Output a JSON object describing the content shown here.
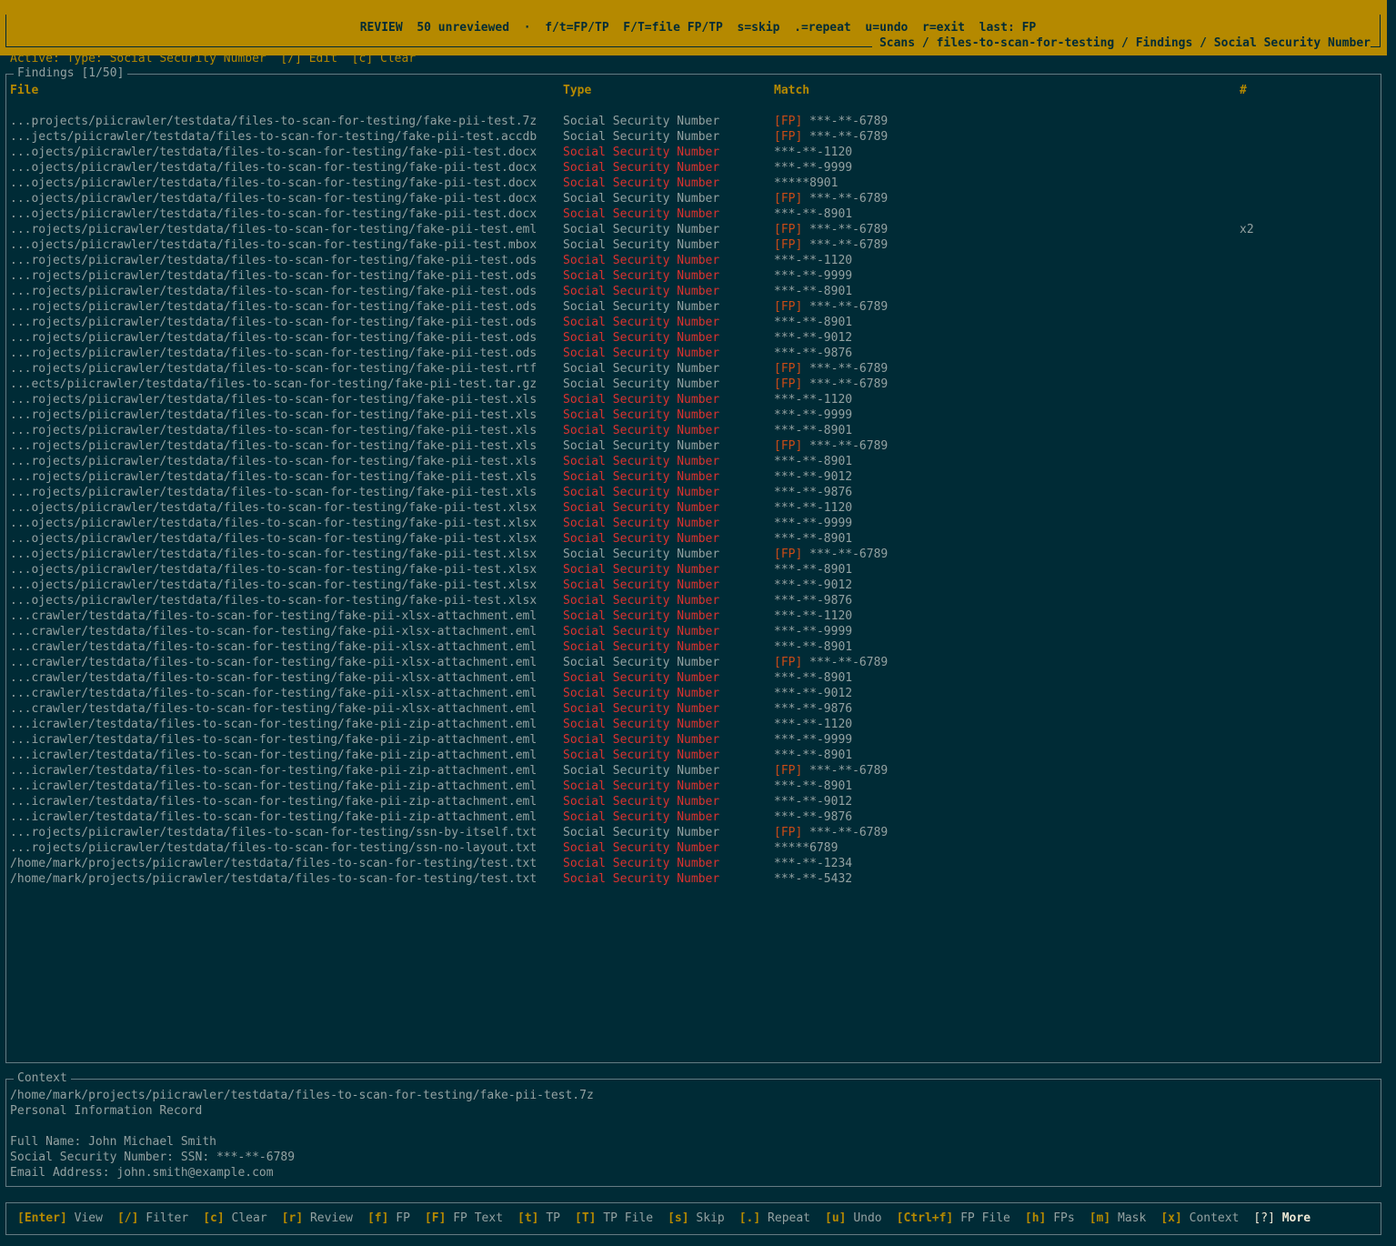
{
  "topbar": {
    "review_line": "REVIEW  50 unreviewed  ·  f/t=FP/TP  F/T=file FP/TP  s=skip  .=repeat  u=undo  r=exit  last: FP",
    "breadcrumb": "Scans / files-to-scan-for-testing / Findings / Social Security Number"
  },
  "active_filter": "Active: Type: Social Security Number  [/] Edit  [c] Clear",
  "findings": {
    "title": "Findings [1/50]",
    "headers": {
      "file": "File",
      "type": "Type",
      "match": "Match",
      "count": "#"
    },
    "rows": [
      {
        "file": "...projects/piicrawler/testdata/files-to-scan-for-testing/fake-pii-test.7z",
        "type": "Social Security Number",
        "fp": "[FP]",
        "match": "***-**-6789",
        "count": "",
        "red": false
      },
      {
        "file": "...jects/piicrawler/testdata/files-to-scan-for-testing/fake-pii-test.accdb",
        "type": "Social Security Number",
        "fp": "[FP]",
        "match": "***-**-6789",
        "count": "",
        "red": false
      },
      {
        "file": "...ojects/piicrawler/testdata/files-to-scan-for-testing/fake-pii-test.docx",
        "type": "Social Security Number",
        "fp": "",
        "match": "***-**-1120",
        "count": "",
        "red": true
      },
      {
        "file": "...ojects/piicrawler/testdata/files-to-scan-for-testing/fake-pii-test.docx",
        "type": "Social Security Number",
        "fp": "",
        "match": "***-**-9999",
        "count": "",
        "red": true
      },
      {
        "file": "...ojects/piicrawler/testdata/files-to-scan-for-testing/fake-pii-test.docx",
        "type": "Social Security Number",
        "fp": "",
        "match": "*****8901",
        "count": "",
        "red": true
      },
      {
        "file": "...ojects/piicrawler/testdata/files-to-scan-for-testing/fake-pii-test.docx",
        "type": "Social Security Number",
        "fp": "[FP]",
        "match": "***-**-6789",
        "count": "",
        "red": false
      },
      {
        "file": "...ojects/piicrawler/testdata/files-to-scan-for-testing/fake-pii-test.docx",
        "type": "Social Security Number",
        "fp": "",
        "match": "***-**-8901",
        "count": "",
        "red": true
      },
      {
        "file": "...rojects/piicrawler/testdata/files-to-scan-for-testing/fake-pii-test.eml",
        "type": "Social Security Number",
        "fp": "[FP]",
        "match": "***-**-6789",
        "count": "x2",
        "red": false
      },
      {
        "file": "...ojects/piicrawler/testdata/files-to-scan-for-testing/fake-pii-test.mbox",
        "type": "Social Security Number",
        "fp": "[FP]",
        "match": "***-**-6789",
        "count": "",
        "red": false
      },
      {
        "file": "...rojects/piicrawler/testdata/files-to-scan-for-testing/fake-pii-test.ods",
        "type": "Social Security Number",
        "fp": "",
        "match": "***-**-1120",
        "count": "",
        "red": true
      },
      {
        "file": "...rojects/piicrawler/testdata/files-to-scan-for-testing/fake-pii-test.ods",
        "type": "Social Security Number",
        "fp": "",
        "match": "***-**-9999",
        "count": "",
        "red": true
      },
      {
        "file": "...rojects/piicrawler/testdata/files-to-scan-for-testing/fake-pii-test.ods",
        "type": "Social Security Number",
        "fp": "",
        "match": "***-**-8901",
        "count": "",
        "red": true
      },
      {
        "file": "...rojects/piicrawler/testdata/files-to-scan-for-testing/fake-pii-test.ods",
        "type": "Social Security Number",
        "fp": "[FP]",
        "match": "***-**-6789",
        "count": "",
        "red": false
      },
      {
        "file": "...rojects/piicrawler/testdata/files-to-scan-for-testing/fake-pii-test.ods",
        "type": "Social Security Number",
        "fp": "",
        "match": "***-**-8901",
        "count": "",
        "red": true
      },
      {
        "file": "...rojects/piicrawler/testdata/files-to-scan-for-testing/fake-pii-test.ods",
        "type": "Social Security Number",
        "fp": "",
        "match": "***-**-9012",
        "count": "",
        "red": true
      },
      {
        "file": "...rojects/piicrawler/testdata/files-to-scan-for-testing/fake-pii-test.ods",
        "type": "Social Security Number",
        "fp": "",
        "match": "***-**-9876",
        "count": "",
        "red": true
      },
      {
        "file": "...rojects/piicrawler/testdata/files-to-scan-for-testing/fake-pii-test.rtf",
        "type": "Social Security Number",
        "fp": "[FP]",
        "match": "***-**-6789",
        "count": "",
        "red": false
      },
      {
        "file": "...ects/piicrawler/testdata/files-to-scan-for-testing/fake-pii-test.tar.gz",
        "type": "Social Security Number",
        "fp": "[FP]",
        "match": "***-**-6789",
        "count": "",
        "red": false
      },
      {
        "file": "...rojects/piicrawler/testdata/files-to-scan-for-testing/fake-pii-test.xls",
        "type": "Social Security Number",
        "fp": "",
        "match": "***-**-1120",
        "count": "",
        "red": true
      },
      {
        "file": "...rojects/piicrawler/testdata/files-to-scan-for-testing/fake-pii-test.xls",
        "type": "Social Security Number",
        "fp": "",
        "match": "***-**-9999",
        "count": "",
        "red": true
      },
      {
        "file": "...rojects/piicrawler/testdata/files-to-scan-for-testing/fake-pii-test.xls",
        "type": "Social Security Number",
        "fp": "",
        "match": "***-**-8901",
        "count": "",
        "red": true
      },
      {
        "file": "...rojects/piicrawler/testdata/files-to-scan-for-testing/fake-pii-test.xls",
        "type": "Social Security Number",
        "fp": "[FP]",
        "match": "***-**-6789",
        "count": "",
        "red": false
      },
      {
        "file": "...rojects/piicrawler/testdata/files-to-scan-for-testing/fake-pii-test.xls",
        "type": "Social Security Number",
        "fp": "",
        "match": "***-**-8901",
        "count": "",
        "red": true
      },
      {
        "file": "...rojects/piicrawler/testdata/files-to-scan-for-testing/fake-pii-test.xls",
        "type": "Social Security Number",
        "fp": "",
        "match": "***-**-9012",
        "count": "",
        "red": true
      },
      {
        "file": "...rojects/piicrawler/testdata/files-to-scan-for-testing/fake-pii-test.xls",
        "type": "Social Security Number",
        "fp": "",
        "match": "***-**-9876",
        "count": "",
        "red": true
      },
      {
        "file": "...ojects/piicrawler/testdata/files-to-scan-for-testing/fake-pii-test.xlsx",
        "type": "Social Security Number",
        "fp": "",
        "match": "***-**-1120",
        "count": "",
        "red": true
      },
      {
        "file": "...ojects/piicrawler/testdata/files-to-scan-for-testing/fake-pii-test.xlsx",
        "type": "Social Security Number",
        "fp": "",
        "match": "***-**-9999",
        "count": "",
        "red": true
      },
      {
        "file": "...ojects/piicrawler/testdata/files-to-scan-for-testing/fake-pii-test.xlsx",
        "type": "Social Security Number",
        "fp": "",
        "match": "***-**-8901",
        "count": "",
        "red": true
      },
      {
        "file": "...ojects/piicrawler/testdata/files-to-scan-for-testing/fake-pii-test.xlsx",
        "type": "Social Security Number",
        "fp": "[FP]",
        "match": "***-**-6789",
        "count": "",
        "red": false
      },
      {
        "file": "...ojects/piicrawler/testdata/files-to-scan-for-testing/fake-pii-test.xlsx",
        "type": "Social Security Number",
        "fp": "",
        "match": "***-**-8901",
        "count": "",
        "red": true
      },
      {
        "file": "...ojects/piicrawler/testdata/files-to-scan-for-testing/fake-pii-test.xlsx",
        "type": "Social Security Number",
        "fp": "",
        "match": "***-**-9012",
        "count": "",
        "red": true
      },
      {
        "file": "...ojects/piicrawler/testdata/files-to-scan-for-testing/fake-pii-test.xlsx",
        "type": "Social Security Number",
        "fp": "",
        "match": "***-**-9876",
        "count": "",
        "red": true
      },
      {
        "file": "...crawler/testdata/files-to-scan-for-testing/fake-pii-xlsx-attachment.eml",
        "type": "Social Security Number",
        "fp": "",
        "match": "***-**-1120",
        "count": "",
        "red": true
      },
      {
        "file": "...crawler/testdata/files-to-scan-for-testing/fake-pii-xlsx-attachment.eml",
        "type": "Social Security Number",
        "fp": "",
        "match": "***-**-9999",
        "count": "",
        "red": true
      },
      {
        "file": "...crawler/testdata/files-to-scan-for-testing/fake-pii-xlsx-attachment.eml",
        "type": "Social Security Number",
        "fp": "",
        "match": "***-**-8901",
        "count": "",
        "red": true
      },
      {
        "file": "...crawler/testdata/files-to-scan-for-testing/fake-pii-xlsx-attachment.eml",
        "type": "Social Security Number",
        "fp": "[FP]",
        "match": "***-**-6789",
        "count": "",
        "red": false
      },
      {
        "file": "...crawler/testdata/files-to-scan-for-testing/fake-pii-xlsx-attachment.eml",
        "type": "Social Security Number",
        "fp": "",
        "match": "***-**-8901",
        "count": "",
        "red": true
      },
      {
        "file": "...crawler/testdata/files-to-scan-for-testing/fake-pii-xlsx-attachment.eml",
        "type": "Social Security Number",
        "fp": "",
        "match": "***-**-9012",
        "count": "",
        "red": true
      },
      {
        "file": "...crawler/testdata/files-to-scan-for-testing/fake-pii-xlsx-attachment.eml",
        "type": "Social Security Number",
        "fp": "",
        "match": "***-**-9876",
        "count": "",
        "red": true
      },
      {
        "file": "...icrawler/testdata/files-to-scan-for-testing/fake-pii-zip-attachment.eml",
        "type": "Social Security Number",
        "fp": "",
        "match": "***-**-1120",
        "count": "",
        "red": true
      },
      {
        "file": "...icrawler/testdata/files-to-scan-for-testing/fake-pii-zip-attachment.eml",
        "type": "Social Security Number",
        "fp": "",
        "match": "***-**-9999",
        "count": "",
        "red": true
      },
      {
        "file": "...icrawler/testdata/files-to-scan-for-testing/fake-pii-zip-attachment.eml",
        "type": "Social Security Number",
        "fp": "",
        "match": "***-**-8901",
        "count": "",
        "red": true
      },
      {
        "file": "...icrawler/testdata/files-to-scan-for-testing/fake-pii-zip-attachment.eml",
        "type": "Social Security Number",
        "fp": "[FP]",
        "match": "***-**-6789",
        "count": "",
        "red": false
      },
      {
        "file": "...icrawler/testdata/files-to-scan-for-testing/fake-pii-zip-attachment.eml",
        "type": "Social Security Number",
        "fp": "",
        "match": "***-**-8901",
        "count": "",
        "red": true
      },
      {
        "file": "...icrawler/testdata/files-to-scan-for-testing/fake-pii-zip-attachment.eml",
        "type": "Social Security Number",
        "fp": "",
        "match": "***-**-9012",
        "count": "",
        "red": true
      },
      {
        "file": "...icrawler/testdata/files-to-scan-for-testing/fake-pii-zip-attachment.eml",
        "type": "Social Security Number",
        "fp": "",
        "match": "***-**-9876",
        "count": "",
        "red": true
      },
      {
        "file": "...rojects/piicrawler/testdata/files-to-scan-for-testing/ssn-by-itself.txt",
        "type": "Social Security Number",
        "fp": "[FP]",
        "match": "***-**-6789",
        "count": "",
        "red": false
      },
      {
        "file": "...rojects/piicrawler/testdata/files-to-scan-for-testing/ssn-no-layout.txt",
        "type": "Social Security Number",
        "fp": "",
        "match": "*****6789",
        "count": "",
        "red": true
      },
      {
        "file": "/home/mark/projects/piicrawler/testdata/files-to-scan-for-testing/test.txt",
        "type": "Social Security Number",
        "fp": "",
        "match": "***-**-1234",
        "count": "",
        "red": true
      },
      {
        "file": "/home/mark/projects/piicrawler/testdata/files-to-scan-for-testing/test.txt",
        "type": "Social Security Number",
        "fp": "",
        "match": "***-**-5432",
        "count": "",
        "red": true
      }
    ]
  },
  "context": {
    "title": "Context",
    "lines": [
      "/home/mark/projects/piicrawler/testdata/files-to-scan-for-testing/fake-pii-test.7z",
      "Personal Information Record",
      "",
      "Full Name: John Michael Smith",
      "Social Security Number: SSN: ***-**-6789",
      "Email Address: john.smith@example.com"
    ]
  },
  "footer": {
    "items": [
      {
        "key": "[Enter]",
        "label": "View"
      },
      {
        "key": "[/]",
        "label": "Filter"
      },
      {
        "key": "[c]",
        "label": "Clear"
      },
      {
        "key": "[r]",
        "label": "Review"
      },
      {
        "key": "[f]",
        "label": "FP"
      },
      {
        "key": "[F]",
        "label": "FP Text"
      },
      {
        "key": "[t]",
        "label": "TP"
      },
      {
        "key": "[T]",
        "label": "TP File"
      },
      {
        "key": "[s]",
        "label": "Skip"
      },
      {
        "key": "[.]",
        "label": "Repeat"
      },
      {
        "key": "[u]",
        "label": "Undo"
      },
      {
        "key": "[Ctrl+f]",
        "label": "FP File"
      },
      {
        "key": "[h]",
        "label": "FPs"
      },
      {
        "key": "[m]",
        "label": "Mask"
      },
      {
        "key": "[x]",
        "label": "Context"
      }
    ],
    "more_key": "[?]",
    "more_label": "More"
  },
  "colors": {
    "background": "#002b36",
    "accent": "#b58900",
    "highlight_red": "#dc322f",
    "fp_tag": "#cb4b16",
    "text": "#93a1a1"
  }
}
